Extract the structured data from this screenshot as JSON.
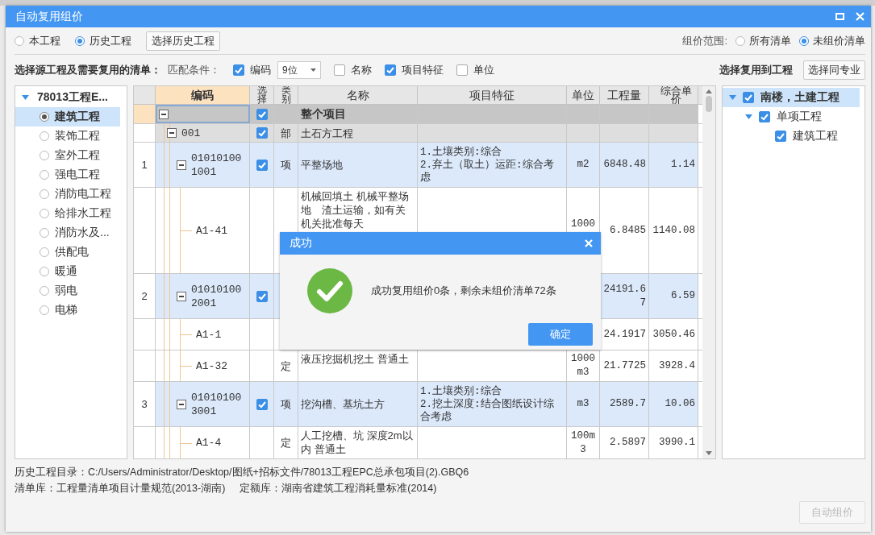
{
  "window": {
    "title": "自动复用组价"
  },
  "source": [
    {
      "label": "本工程",
      "selected": false
    },
    {
      "label": "历史工程",
      "selected": true
    }
  ],
  "choose_history_button": "选择历史工程",
  "price_scope": {
    "label": "组价范围:",
    "options": [
      {
        "label": "所有清单",
        "selected": false
      },
      {
        "label": "未组价清单",
        "selected": true
      }
    ]
  },
  "match_bar": {
    "title": "选择源工程及需要复用的清单：",
    "label": "匹配条件：",
    "conditions": [
      {
        "label": "编码",
        "checked": true,
        "digits": "9位"
      },
      {
        "label": "名称",
        "checked": false
      },
      {
        "label": "项目特征",
        "checked": true
      },
      {
        "label": "单位",
        "checked": false
      }
    ]
  },
  "target_label": "选择复用到工程",
  "same_major_button": "选择同专业",
  "source_tree": {
    "label": "78013工程E...",
    "expanded": true,
    "children": [
      {
        "label": "建筑工程",
        "selected": true
      },
      {
        "label": "装饰工程",
        "selected": false
      },
      {
        "label": "室外工程",
        "selected": false
      },
      {
        "label": "强电工程",
        "selected": false
      },
      {
        "label": "消防电工程",
        "selected": false
      },
      {
        "label": "给排水工程",
        "selected": false
      },
      {
        "label": "消防水及...",
        "selected": false
      },
      {
        "label": "供配电",
        "selected": false
      },
      {
        "label": "暖通",
        "selected": false
      },
      {
        "label": "弱电",
        "selected": false
      },
      {
        "label": "电梯",
        "selected": false
      }
    ]
  },
  "table": {
    "columns": [
      {
        "label": "编码",
        "highlighted": true
      },
      {
        "label": "选择",
        "highlighted": false
      },
      {
        "label": "类别",
        "highlighted": false
      },
      {
        "label": "名称",
        "highlighted": false
      },
      {
        "label": "项目特征",
        "highlighted": false
      },
      {
        "label": "单位",
        "highlighted": false
      },
      {
        "label": "工程量",
        "highlighted": false
      },
      {
        "label": "综合单价",
        "highlighted": false
      }
    ],
    "rows": [
      {
        "kind": "root",
        "selected": true,
        "expanded": true,
        "checked": true,
        "name": "整个项目"
      },
      {
        "kind": "section",
        "selected": false,
        "expanded": true,
        "code": "001",
        "checked": true,
        "category": "部",
        "name": "土石方工程"
      },
      {
        "kind": "item",
        "selected": false,
        "expanded": true,
        "index": "1",
        "code": "010101001001",
        "checked": true,
        "category": "项",
        "name": "平整场地",
        "features": "1.土壤类别:综合\n2.弃土（取土）运距:综合考虑",
        "unit": "m2",
        "quantity": "6848.48",
        "price": "1.14"
      },
      {
        "kind": "quota",
        "selected": false,
        "code": "A1-41",
        "name": "机械回填土 机械平整场地　渣土运输，如有关机关批准每天",
        "unit": "1000",
        "quantity": "6.8485",
        "price": "1140.08"
      },
      {
        "kind": "item",
        "selected": false,
        "expanded": true,
        "index": "2",
        "code": "010101002001",
        "checked": true,
        "quantity": "24191.67",
        "price": "6.59"
      },
      {
        "kind": "quota",
        "selected": false,
        "code": "A1-1",
        "quantity": "24.1917",
        "price": "3050.46"
      },
      {
        "kind": "quota",
        "selected": false,
        "code": "A1-32",
        "category": "定",
        "name": "液压挖掘机挖土 普通土",
        "unit": "1000m3",
        "quantity": "21.7725",
        "price": "3928.4"
      },
      {
        "kind": "item",
        "selected": false,
        "expanded": true,
        "index": "3",
        "code": "010101003001",
        "checked": true,
        "category": "项",
        "name": "挖沟槽、基坑土方",
        "features": "1.土壤类别:综合\n2.挖土深度:结合图纸设计综合考虑",
        "unit": "m3",
        "quantity": "2589.7",
        "price": "10.06"
      },
      {
        "kind": "quota",
        "selected": false,
        "code": "A1-4",
        "category": "定",
        "name": "人工挖槽、坑 深度2m以内 普通土",
        "unit": "100m3",
        "quantity": "2.5897",
        "price": "3990.1"
      }
    ]
  },
  "target_tree": [
    {
      "label": "南楼，土建工程",
      "checked": true,
      "expanded": true,
      "selected": true,
      "children": [
        {
          "label": "单项工程",
          "checked": true,
          "expanded": true,
          "selected": false,
          "children": [
            {
              "label": "建筑工程",
              "checked": true,
              "selected": false
            }
          ]
        }
      ]
    }
  ],
  "footer": {
    "history_dir": "历史工程目录：C:/Users/Administrator/Desktop/图纸+招标文件/78013工程EPC总承包项目(2).GBQ6",
    "bill_lib": "清单库：工程量清单项目计量规范(2013-湖南)",
    "quota_lib": "定额库：湖南省建筑工程消耗量标准(2014)"
  },
  "auto_price_button": {
    "label": "自动组价",
    "disabled": true
  },
  "dialog": {
    "title": "成功",
    "message": "成功复用组价0条，剩余未组价清单72条",
    "ok_button": "确定"
  }
}
